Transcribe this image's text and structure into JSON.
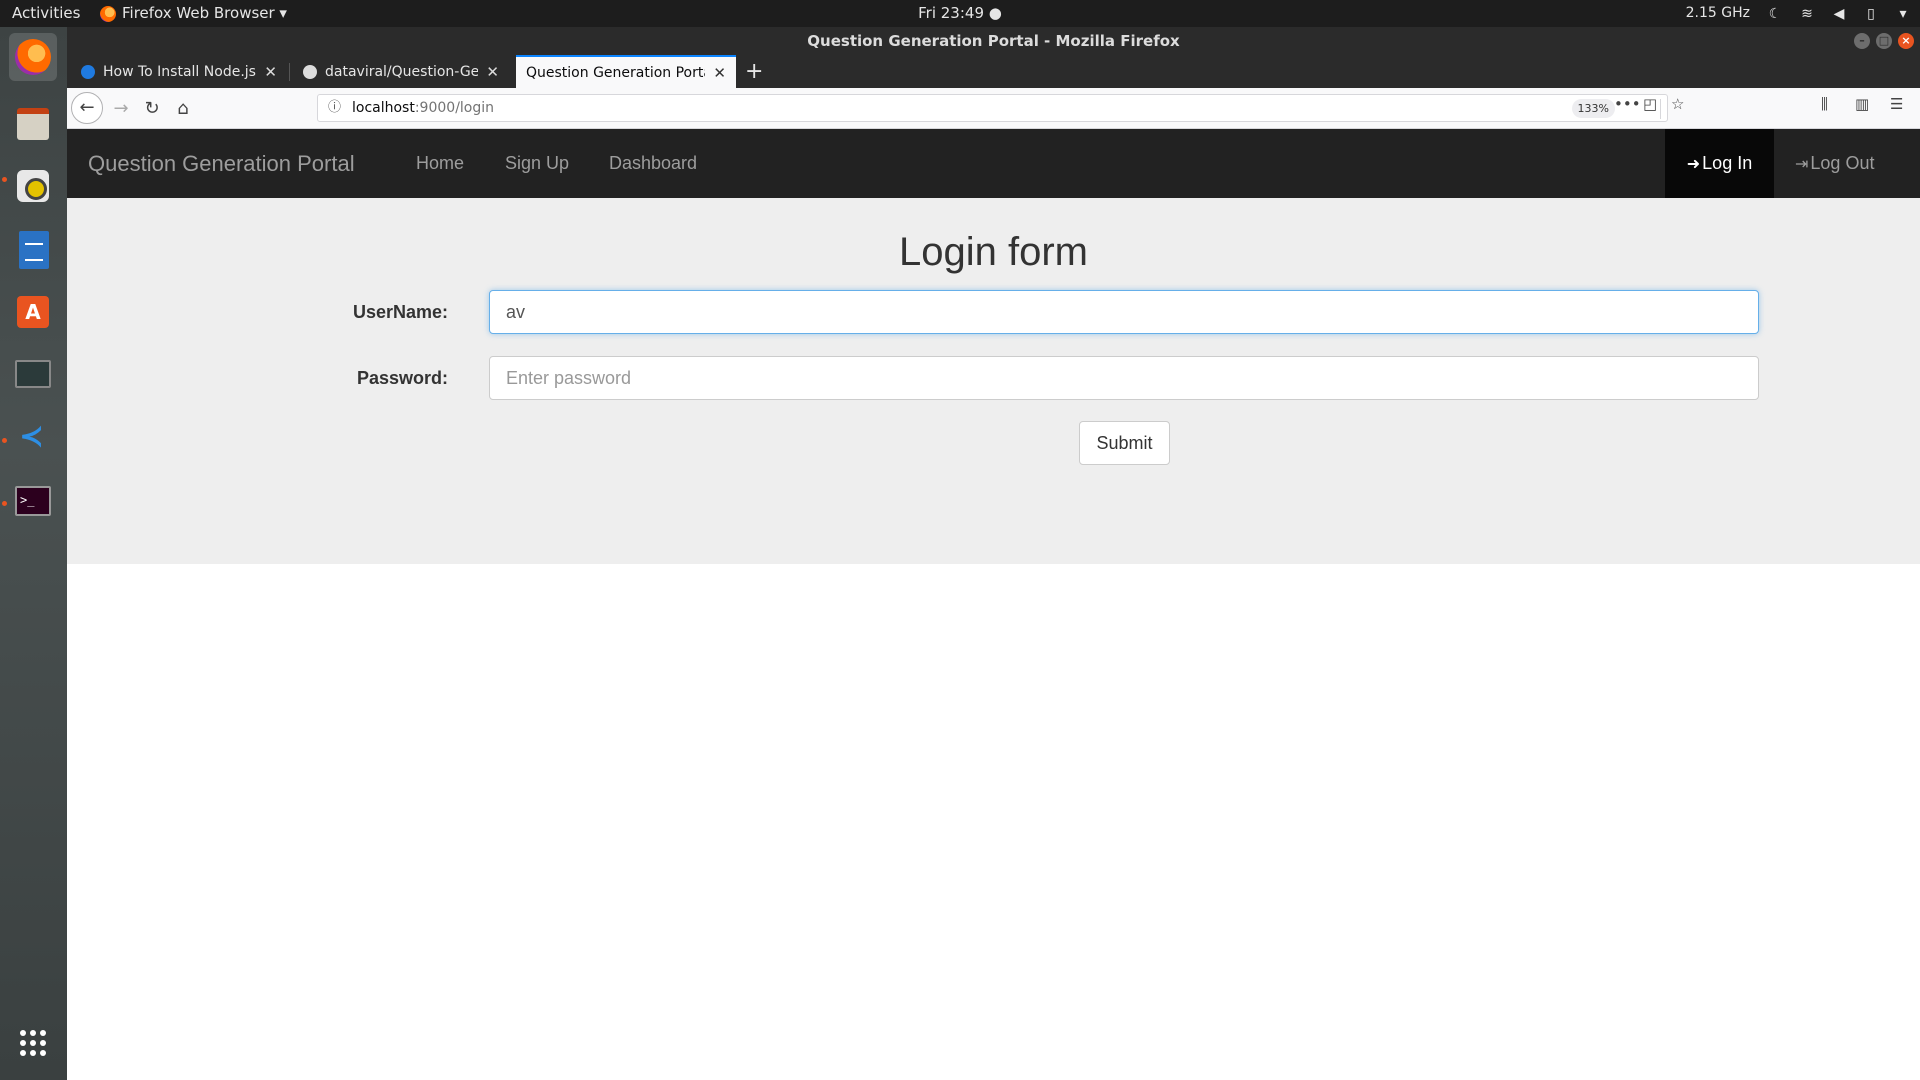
{
  "system": {
    "activities": "Activities",
    "app_menu": "Firefox Web Browser ▾",
    "clock": "Fri 23:49 ●",
    "cpu_freq": "2.15 GHz"
  },
  "window": {
    "title": "Question Generation Portal - Mozilla Firefox"
  },
  "tabs": [
    {
      "title": "How To Install Node.js o",
      "icon": "digitalocean-icon"
    },
    {
      "title": "dataviral/Question-Gene",
      "icon": "github-icon"
    },
    {
      "title": "Question Generation Portal",
      "icon": "none",
      "active": true
    }
  ],
  "urlbar": {
    "host": "localhost",
    "path": ":9000/login",
    "zoom": "133%"
  },
  "site": {
    "brand": "Question Generation Portal",
    "nav": {
      "home": "Home",
      "signup": "Sign Up",
      "dashboard": "Dashboard",
      "login": "Log In",
      "logout": "Log Out"
    }
  },
  "form": {
    "title": "Login form",
    "username_label": "UserName:",
    "username_value": "av",
    "password_label": "Password:",
    "password_placeholder": "Enter password",
    "submit": "Submit"
  },
  "colors": {
    "navbar_bg": "#222222",
    "jumbotron_bg": "#eeeeee",
    "focus_border": "#66afe9",
    "accent": "#e95420"
  }
}
